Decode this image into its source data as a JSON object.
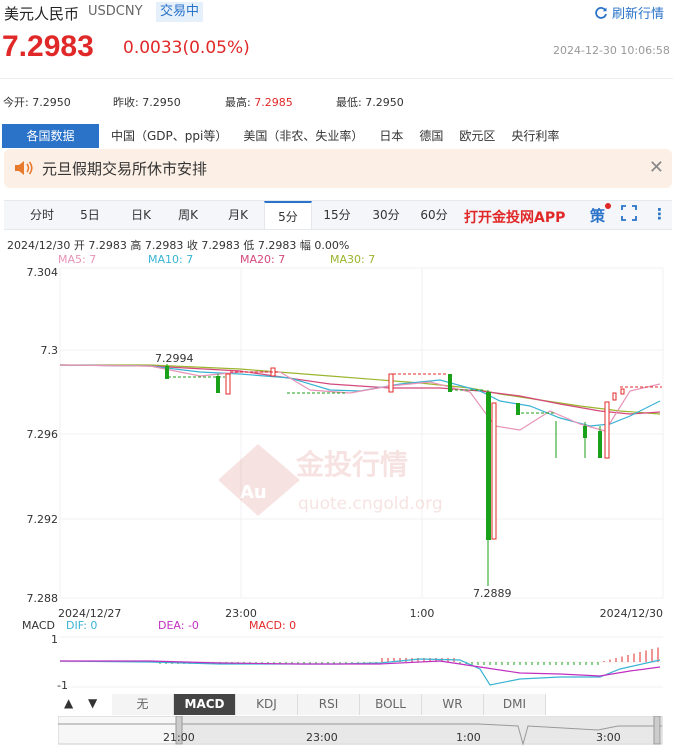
{
  "header": {
    "name": "美元人民币",
    "code": "USDCNY",
    "status": "交易中",
    "refresh_label": "刷新行情",
    "price": "7.2983",
    "change": "0.0033(0.05%)",
    "timestamp": "2024-12-30 10:06:58"
  },
  "stats": [
    {
      "label": "今开:",
      "value": "7.2950",
      "red": false
    },
    {
      "label": "昨收:",
      "value": "7.2950",
      "red": false
    },
    {
      "label": "最高:",
      "value": "7.2985",
      "red": true
    },
    {
      "label": "最低:",
      "value": "7.2950",
      "red": false
    }
  ],
  "tabs": [
    "各国数据",
    "中国（GDP、ppi等）",
    "美国（非农、失业率）",
    "日本",
    "德国",
    "欧元区",
    "央行利率"
  ],
  "notice": {
    "text": "元旦假期交易所休市安排"
  },
  "period_tabs": [
    "分时",
    "5日",
    "日K",
    "周K",
    "月K",
    "5分",
    "15分",
    "30分",
    "60分"
  ],
  "app_link": "打开金投网APP",
  "ohlc_line": "2024/12/30  开 7.2983  高 7.2983  收 7.2983  低 7.2983  幅 0.00%",
  "ma": {
    "ma5": "MA5: 7",
    "ma10": "MA10: 7",
    "ma20": "MA20: 7",
    "ma30": "MA30: 7"
  },
  "watermark": {
    "text": "金投行情",
    "url": "quote.cngold.org"
  },
  "chart": {
    "y_ticks": [
      "7.304",
      "7.3",
      "7.296",
      "7.292",
      "7.288"
    ],
    "x_ticks": [
      "2024/12/27",
      "23:00",
      "1:00",
      "2024/12/30"
    ],
    "max_label": "7.2994",
    "min_label": "7.2889"
  },
  "macd": {
    "label": "MACD",
    "dif": "DIF: 0",
    "dea": "DEA: -0",
    "macd": "MACD: 0",
    "y_top": "1",
    "y_bottom": "-1"
  },
  "indicator_tabs": [
    "无",
    "MACD",
    "KDJ",
    "RSI",
    "BOLL",
    "WR",
    "DMI"
  ],
  "nav_ticks": [
    "21:00",
    "23:00",
    "1:00",
    "3:00"
  ],
  "chart_data": {
    "type": "candlestick",
    "ylim": [
      7.288,
      7.304
    ],
    "y_ticks": [
      7.304,
      7.3,
      7.296,
      7.292,
      7.288
    ],
    "x_ticks": [
      "2024/12/27",
      "23:00",
      "1:00",
      "2024/12/30"
    ],
    "annotations": [
      {
        "label": "7.2994",
        "value": 7.2994
      },
      {
        "label": "7.2889",
        "value": 7.2889
      }
    ],
    "colors": {
      "up": "#e12828",
      "down": "#1aa11a",
      "ma5": "#e893b7",
      "ma10": "#39b3d4",
      "ma20": "#d4487b",
      "ma30": "#9ab52e"
    }
  }
}
